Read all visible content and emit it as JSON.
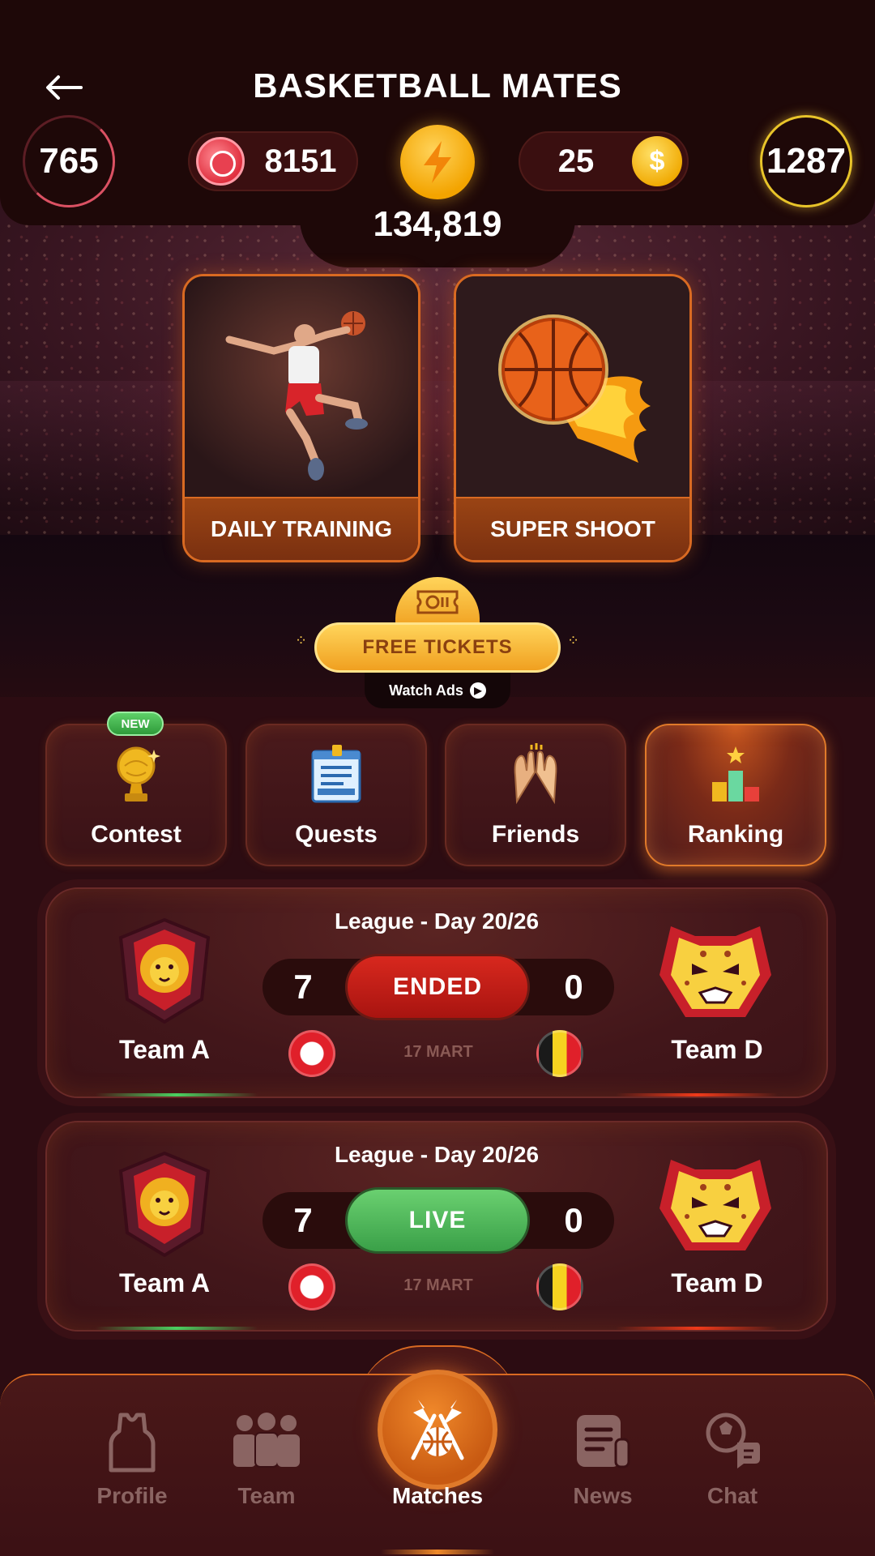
{
  "header": {
    "title": "BASKETBALL MATES",
    "left_ring_value": "765",
    "right_ring_value": "1287",
    "balls_value": "8151",
    "coins_value": "25",
    "energy_value": "134,819",
    "icons": {
      "back": "arrow-left-icon",
      "ball": "basketball-icon",
      "bolt": "lightning-icon",
      "coin": "dollar-coin-icon"
    }
  },
  "game_cards": [
    {
      "label": "DAILY TRAINING",
      "icon": "dunking-player-icon"
    },
    {
      "label": "SUPER SHOOT",
      "icon": "flaming-basketball-icon"
    }
  ],
  "tickets": {
    "button_label": "FREE TICKETS",
    "watch_ads_label": "Watch Ads",
    "icons": {
      "ticket": "ticket-icon",
      "play": "play-icon"
    }
  },
  "tiles": [
    {
      "label": "Contest",
      "badge": "NEW",
      "icon": "trophy-icon"
    },
    {
      "label": "Quests",
      "icon": "scroll-icon"
    },
    {
      "label": "Friends",
      "icon": "high-five-icon"
    },
    {
      "label": "Ranking",
      "icon": "podium-icon",
      "active": true
    }
  ],
  "matches": [
    {
      "league": "League - Day 20/26",
      "home_team": "Team A",
      "away_team": "Team D",
      "home_score": "7",
      "away_score": "0",
      "status": "ENDED",
      "date": "17 MART",
      "home_flag": "tunisia-flag",
      "away_flag": "belgium-flag",
      "status_color": "#c81e16"
    },
    {
      "league": "League - Day 20/26",
      "home_team": "Team A",
      "away_team": "Team D",
      "home_score": "7",
      "away_score": "0",
      "status": "LIVE",
      "date": "17 MART",
      "home_flag": "tunisia-flag",
      "away_flag": "belgium-flag",
      "status_color": "#52b85c"
    }
  ],
  "nav": {
    "items": [
      {
        "label": "Profile",
        "icon": "jersey-icon"
      },
      {
        "label": "Team",
        "icon": "team-icon"
      },
      {
        "label": "Matches",
        "icon": "crossed-flags-basketball-icon",
        "active": true
      },
      {
        "label": "News",
        "icon": "newspaper-icon"
      },
      {
        "label": "Chat",
        "icon": "chat-icon"
      }
    ]
  },
  "colors": {
    "accent_orange": "#d96a22",
    "gold": "#f0a800",
    "background": "#2c0c12",
    "live_green": "#52b85c",
    "ended_red": "#c81e16"
  }
}
